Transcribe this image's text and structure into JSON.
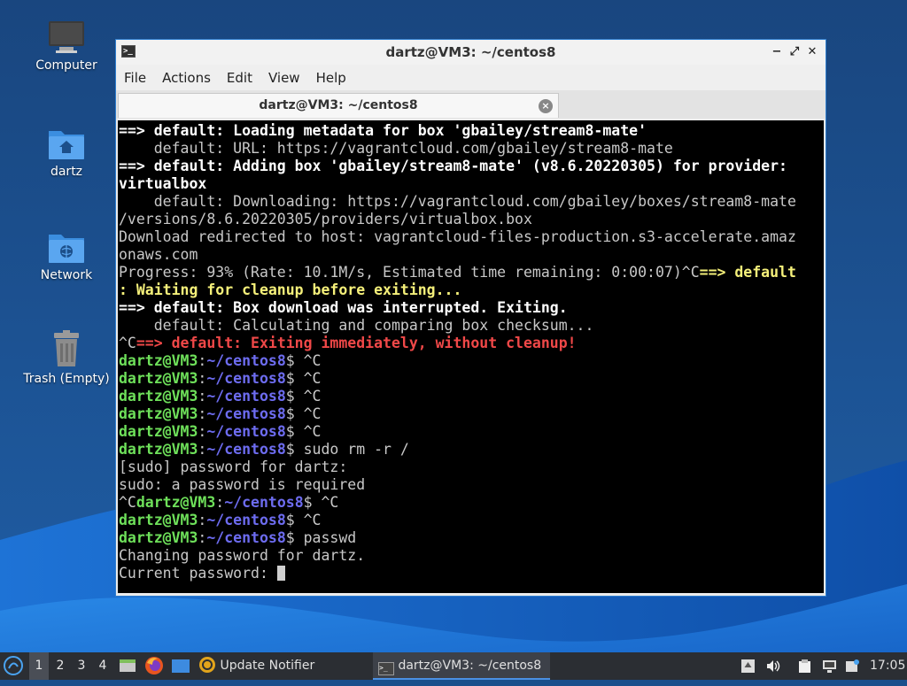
{
  "desktop": {
    "icons": [
      {
        "label": "Computer",
        "icon": "computer-icon"
      },
      {
        "label": "dartz",
        "icon": "home-folder-icon"
      },
      {
        "label": "Network",
        "icon": "network-folder-icon"
      },
      {
        "label": "Trash (Empty)",
        "icon": "trash-icon"
      }
    ]
  },
  "window": {
    "title": "dartz@VM3: ~/centos8",
    "controls": [
      "−",
      "⤢",
      "✕"
    ],
    "menu": [
      "File",
      "Actions",
      "Edit",
      "View",
      "Help"
    ],
    "tab_title": "dartz@VM3: ~/centos8"
  },
  "terminal": {
    "lines": [
      [
        {
          "t": "==> default: Loading metadata for box 'gbailey/stream8-mate'",
          "c": "w"
        }
      ],
      [
        {
          "t": "    default: URL: https://vagrantcloud.com/gbailey/stream8-mate",
          "c": "n"
        }
      ],
      [
        {
          "t": "==> default: Adding box 'gbailey/stream8-mate' (v8.6.20220305) for provider:",
          "c": "w"
        }
      ],
      [
        {
          "t": "virtualbox",
          "c": "w"
        }
      ],
      [
        {
          "t": "    default: Downloading: https://vagrantcloud.com/gbailey/boxes/stream8-mate",
          "c": "n"
        }
      ],
      [
        {
          "t": "/versions/8.6.20220305/providers/virtualbox.box",
          "c": "n"
        }
      ],
      [
        {
          "t": "Download redirected to host: vagrantcloud-files-production.s3-accelerate.amaz",
          "c": "n"
        }
      ],
      [
        {
          "t": "onaws.com",
          "c": "n"
        }
      ],
      [
        {
          "t": "Progress: 93% (Rate: 10.1M/s, Estimated time remaining: 0:00:07)^C",
          "c": "n"
        },
        {
          "t": "==> default",
          "c": "y"
        }
      ],
      [
        {
          "t": ": Waiting for cleanup before exiting...",
          "c": "y"
        }
      ],
      [
        {
          "t": "==> default: Box download was interrupted. Exiting.",
          "c": "w"
        }
      ],
      [
        {
          "t": "    default: Calculating and comparing box checksum...",
          "c": "n"
        }
      ],
      [
        {
          "t": "^C",
          "c": "n"
        },
        {
          "t": "==> default: Exiting immediately, without cleanup!",
          "c": "r"
        }
      ],
      [
        {
          "t": "dartz@VM3",
          "c": "g"
        },
        {
          "t": ":",
          "c": "n"
        },
        {
          "t": "~/centos8",
          "c": "b"
        },
        {
          "t": "$ ^C",
          "c": "n"
        }
      ],
      [
        {
          "t": "dartz@VM3",
          "c": "g"
        },
        {
          "t": ":",
          "c": "n"
        },
        {
          "t": "~/centos8",
          "c": "b"
        },
        {
          "t": "$ ^C",
          "c": "n"
        }
      ],
      [
        {
          "t": "dartz@VM3",
          "c": "g"
        },
        {
          "t": ":",
          "c": "n"
        },
        {
          "t": "~/centos8",
          "c": "b"
        },
        {
          "t": "$ ^C",
          "c": "n"
        }
      ],
      [
        {
          "t": "dartz@VM3",
          "c": "g"
        },
        {
          "t": ":",
          "c": "n"
        },
        {
          "t": "~/centos8",
          "c": "b"
        },
        {
          "t": "$ ^C",
          "c": "n"
        }
      ],
      [
        {
          "t": "dartz@VM3",
          "c": "g"
        },
        {
          "t": ":",
          "c": "n"
        },
        {
          "t": "~/centos8",
          "c": "b"
        },
        {
          "t": "$ ^C",
          "c": "n"
        }
      ],
      [
        {
          "t": "dartz@VM3",
          "c": "g"
        },
        {
          "t": ":",
          "c": "n"
        },
        {
          "t": "~/centos8",
          "c": "b"
        },
        {
          "t": "$ sudo rm -r /",
          "c": "n"
        }
      ],
      [
        {
          "t": "[sudo] password for dartz:",
          "c": "n"
        }
      ],
      [
        {
          "t": "sudo: a password is required",
          "c": "n"
        }
      ],
      [
        {
          "t": "^C",
          "c": "n"
        },
        {
          "t": "dartz@VM3",
          "c": "g"
        },
        {
          "t": ":",
          "c": "n"
        },
        {
          "t": "~/centos8",
          "c": "b"
        },
        {
          "t": "$ ^C",
          "c": "n"
        }
      ],
      [
        {
          "t": "dartz@VM3",
          "c": "g"
        },
        {
          "t": ":",
          "c": "n"
        },
        {
          "t": "~/centos8",
          "c": "b"
        },
        {
          "t": "$ ^C",
          "c": "n"
        }
      ],
      [
        {
          "t": "dartz@VM3",
          "c": "g"
        },
        {
          "t": ":",
          "c": "n"
        },
        {
          "t": "~/centos8",
          "c": "b"
        },
        {
          "t": "$ passwd",
          "c": "n"
        }
      ],
      [
        {
          "t": "Changing password for dartz.",
          "c": "n"
        }
      ],
      [
        {
          "t": "Current password: ",
          "c": "n"
        }
      ]
    ]
  },
  "taskbar": {
    "workspaces": [
      "1",
      "2",
      "3",
      "4"
    ],
    "active_workspace": "1",
    "update_notifier": "Update Notifier",
    "terminal_task": "dartz@VM3: ~/centos8",
    "clock": "17:05"
  },
  "colors": {
    "window_border": "#2f7fd0",
    "taskbar": "#2b2e33",
    "prompt_user": "#6ee05a",
    "prompt_path": "#6d6cf0",
    "warning": "#f5f07a",
    "error": "#f04848"
  }
}
